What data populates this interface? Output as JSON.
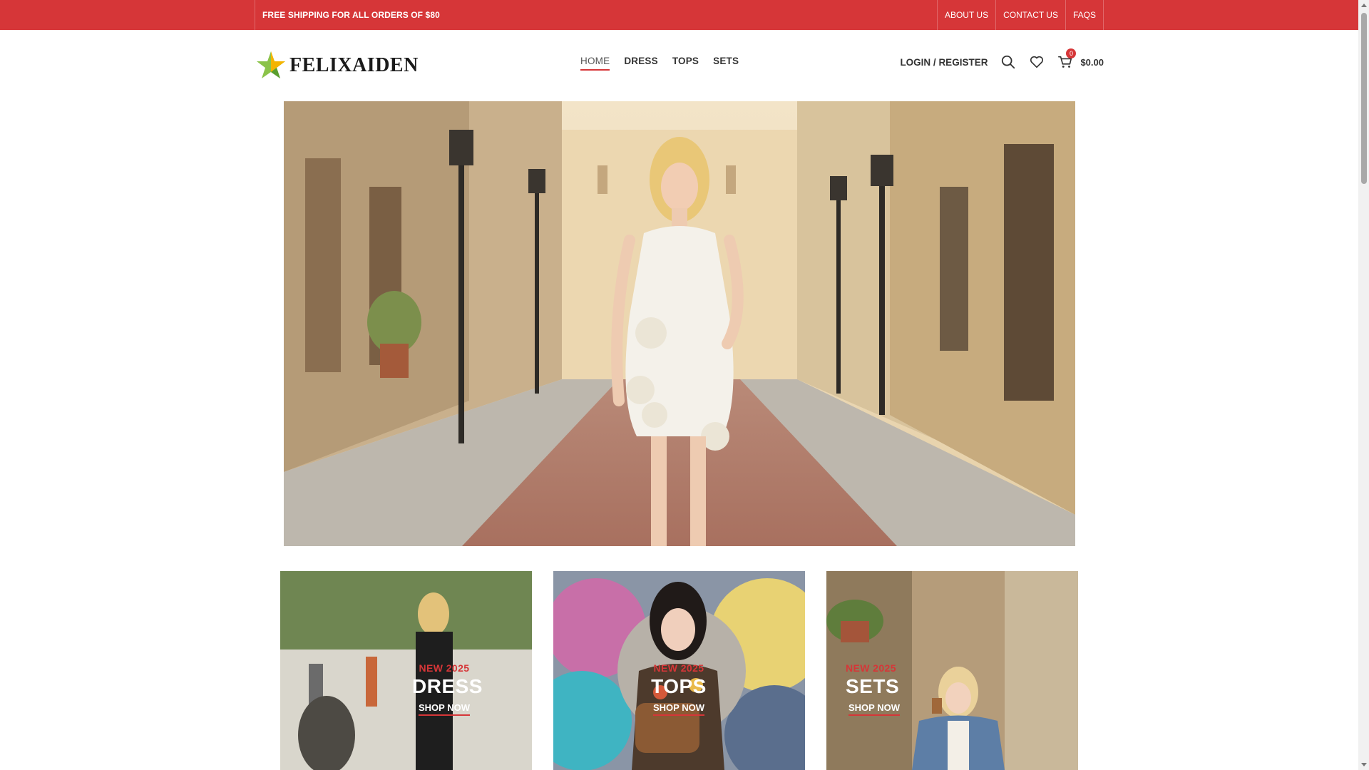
{
  "topbar": {
    "promo": "FREE SHIPPING FOR ALL ORDERS OF $80",
    "links": [
      "ABOUT US",
      "CONTACT US",
      "FAQS"
    ],
    "bg_color": "#d63638"
  },
  "header": {
    "logo_text": "FELIXAIDEN",
    "nav": [
      "HOME",
      "DRESS",
      "TOPS",
      "SETS"
    ],
    "active_nav": "HOME",
    "login": "LOGIN / REGISTER",
    "cart_count": "0",
    "cart_total": "$0.00",
    "icons": [
      "search-icon",
      "heart-icon",
      "cart-icon"
    ]
  },
  "cards": [
    {
      "tag": "NEW 2025",
      "title": "DRESS",
      "cta": "SHOP NOW"
    },
    {
      "tag": "NEW 2025",
      "title": "TOPS",
      "cta": "SHOP NOW"
    },
    {
      "tag": "NEW 2025",
      "title": "SETS",
      "cta": "SHOP NOW"
    }
  ],
  "colors": {
    "accent": "#d63638"
  }
}
